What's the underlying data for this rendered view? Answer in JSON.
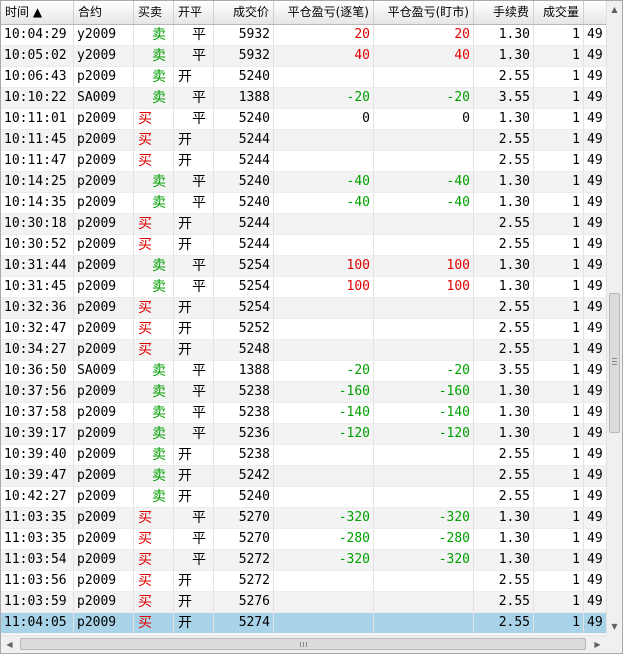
{
  "columns": [
    {
      "label": "时间 ▲",
      "align": "l"
    },
    {
      "label": "合约",
      "align": "l"
    },
    {
      "label": "买卖",
      "align": "l"
    },
    {
      "label": "开平",
      "align": "l"
    },
    {
      "label": "成交价",
      "align": "r"
    },
    {
      "label": "平仓盈亏(逐笔)",
      "align": "r"
    },
    {
      "label": "平仓盈亏(盯市)",
      "align": "r"
    },
    {
      "label": "手续费",
      "align": "r"
    },
    {
      "label": "成交量",
      "align": "r"
    },
    {
      "label": "",
      "align": "l"
    }
  ],
  "rows": [
    {
      "time": "10:04:29",
      "contract": "y2009",
      "side": "卖",
      "side_color": "green",
      "oc": "平",
      "price": "5932",
      "pnl_trade": "20",
      "pnl_mark": "20",
      "pnl_color": "red",
      "fee": "1.30",
      "qty": "1",
      "extra": "49"
    },
    {
      "time": "10:05:02",
      "contract": "y2009",
      "side": "卖",
      "side_color": "green",
      "oc": "平",
      "price": "5932",
      "pnl_trade": "40",
      "pnl_mark": "40",
      "pnl_color": "red",
      "fee": "1.30",
      "qty": "1",
      "extra": "49"
    },
    {
      "time": "10:06:43",
      "contract": "p2009",
      "side": "卖",
      "side_color": "green",
      "oc": "开",
      "price": "5240",
      "pnl_trade": "",
      "pnl_mark": "",
      "pnl_color": "black",
      "fee": "2.55",
      "qty": "1",
      "extra": "49"
    },
    {
      "time": "10:10:22",
      "contract": "SA009",
      "side": "卖",
      "side_color": "green",
      "oc": "平",
      "price": "1388",
      "pnl_trade": "-20",
      "pnl_mark": "-20",
      "pnl_color": "green",
      "fee": "3.55",
      "qty": "1",
      "extra": "49"
    },
    {
      "time": "10:11:01",
      "contract": "p2009",
      "side": "买",
      "side_color": "red",
      "oc": "平",
      "price": "5240",
      "pnl_trade": "0",
      "pnl_mark": "0",
      "pnl_color": "black",
      "fee": "1.30",
      "qty": "1",
      "extra": "49"
    },
    {
      "time": "10:11:45",
      "contract": "p2009",
      "side": "买",
      "side_color": "red",
      "oc": "开",
      "price": "5244",
      "pnl_trade": "",
      "pnl_mark": "",
      "pnl_color": "black",
      "fee": "2.55",
      "qty": "1",
      "extra": "49"
    },
    {
      "time": "10:11:47",
      "contract": "p2009",
      "side": "买",
      "side_color": "red",
      "oc": "开",
      "price": "5244",
      "pnl_trade": "",
      "pnl_mark": "",
      "pnl_color": "black",
      "fee": "2.55",
      "qty": "1",
      "extra": "49"
    },
    {
      "time": "10:14:25",
      "contract": "p2009",
      "side": "卖",
      "side_color": "green",
      "oc": "平",
      "price": "5240",
      "pnl_trade": "-40",
      "pnl_mark": "-40",
      "pnl_color": "green",
      "fee": "1.30",
      "qty": "1",
      "extra": "49"
    },
    {
      "time": "10:14:35",
      "contract": "p2009",
      "side": "卖",
      "side_color": "green",
      "oc": "平",
      "price": "5240",
      "pnl_trade": "-40",
      "pnl_mark": "-40",
      "pnl_color": "green",
      "fee": "1.30",
      "qty": "1",
      "extra": "49"
    },
    {
      "time": "10:30:18",
      "contract": "p2009",
      "side": "买",
      "side_color": "red",
      "oc": "开",
      "price": "5244",
      "pnl_trade": "",
      "pnl_mark": "",
      "pnl_color": "black",
      "fee": "2.55",
      "qty": "1",
      "extra": "49"
    },
    {
      "time": "10:30:52",
      "contract": "p2009",
      "side": "买",
      "side_color": "red",
      "oc": "开",
      "price": "5244",
      "pnl_trade": "",
      "pnl_mark": "",
      "pnl_color": "black",
      "fee": "2.55",
      "qty": "1",
      "extra": "49"
    },
    {
      "time": "10:31:44",
      "contract": "p2009",
      "side": "卖",
      "side_color": "green",
      "oc": "平",
      "price": "5254",
      "pnl_trade": "100",
      "pnl_mark": "100",
      "pnl_color": "red",
      "fee": "1.30",
      "qty": "1",
      "extra": "49"
    },
    {
      "time": "10:31:45",
      "contract": "p2009",
      "side": "卖",
      "side_color": "green",
      "oc": "平",
      "price": "5254",
      "pnl_trade": "100",
      "pnl_mark": "100",
      "pnl_color": "red",
      "fee": "1.30",
      "qty": "1",
      "extra": "49"
    },
    {
      "time": "10:32:36",
      "contract": "p2009",
      "side": "买",
      "side_color": "red",
      "oc": "开",
      "price": "5254",
      "pnl_trade": "",
      "pnl_mark": "",
      "pnl_color": "black",
      "fee": "2.55",
      "qty": "1",
      "extra": "49"
    },
    {
      "time": "10:32:47",
      "contract": "p2009",
      "side": "买",
      "side_color": "red",
      "oc": "开",
      "price": "5252",
      "pnl_trade": "",
      "pnl_mark": "",
      "pnl_color": "black",
      "fee": "2.55",
      "qty": "1",
      "extra": "49"
    },
    {
      "time": "10:34:27",
      "contract": "p2009",
      "side": "买",
      "side_color": "red",
      "oc": "开",
      "price": "5248",
      "pnl_trade": "",
      "pnl_mark": "",
      "pnl_color": "black",
      "fee": "2.55",
      "qty": "1",
      "extra": "49"
    },
    {
      "time": "10:36:50",
      "contract": "SA009",
      "side": "卖",
      "side_color": "green",
      "oc": "平",
      "price": "1388",
      "pnl_trade": "-20",
      "pnl_mark": "-20",
      "pnl_color": "green",
      "fee": "3.55",
      "qty": "1",
      "extra": "49"
    },
    {
      "time": "10:37:56",
      "contract": "p2009",
      "side": "卖",
      "side_color": "green",
      "oc": "平",
      "price": "5238",
      "pnl_trade": "-160",
      "pnl_mark": "-160",
      "pnl_color": "green",
      "fee": "1.30",
      "qty": "1",
      "extra": "49"
    },
    {
      "time": "10:37:58",
      "contract": "p2009",
      "side": "卖",
      "side_color": "green",
      "oc": "平",
      "price": "5238",
      "pnl_trade": "-140",
      "pnl_mark": "-140",
      "pnl_color": "green",
      "fee": "1.30",
      "qty": "1",
      "extra": "49"
    },
    {
      "time": "10:39:17",
      "contract": "p2009",
      "side": "卖",
      "side_color": "green",
      "oc": "平",
      "price": "5236",
      "pnl_trade": "-120",
      "pnl_mark": "-120",
      "pnl_color": "green",
      "fee": "1.30",
      "qty": "1",
      "extra": "49"
    },
    {
      "time": "10:39:40",
      "contract": "p2009",
      "side": "卖",
      "side_color": "green",
      "oc": "开",
      "price": "5238",
      "pnl_trade": "",
      "pnl_mark": "",
      "pnl_color": "black",
      "fee": "2.55",
      "qty": "1",
      "extra": "49"
    },
    {
      "time": "10:39:47",
      "contract": "p2009",
      "side": "卖",
      "side_color": "green",
      "oc": "开",
      "price": "5242",
      "pnl_trade": "",
      "pnl_mark": "",
      "pnl_color": "black",
      "fee": "2.55",
      "qty": "1",
      "extra": "49"
    },
    {
      "time": "10:42:27",
      "contract": "p2009",
      "side": "卖",
      "side_color": "green",
      "oc": "开",
      "price": "5240",
      "pnl_trade": "",
      "pnl_mark": "",
      "pnl_color": "black",
      "fee": "2.55",
      "qty": "1",
      "extra": "49"
    },
    {
      "time": "11:03:35",
      "contract": "p2009",
      "side": "买",
      "side_color": "red",
      "oc": "平",
      "price": "5270",
      "pnl_trade": "-320",
      "pnl_mark": "-320",
      "pnl_color": "green",
      "fee": "1.30",
      "qty": "1",
      "extra": "49"
    },
    {
      "time": "11:03:35",
      "contract": "p2009",
      "side": "买",
      "side_color": "red",
      "oc": "平",
      "price": "5270",
      "pnl_trade": "-280",
      "pnl_mark": "-280",
      "pnl_color": "green",
      "fee": "1.30",
      "qty": "1",
      "extra": "49"
    },
    {
      "time": "11:03:54",
      "contract": "p2009",
      "side": "买",
      "side_color": "red",
      "oc": "平",
      "price": "5272",
      "pnl_trade": "-320",
      "pnl_mark": "-320",
      "pnl_color": "green",
      "fee": "1.30",
      "qty": "1",
      "extra": "49"
    },
    {
      "time": "11:03:56",
      "contract": "p2009",
      "side": "买",
      "side_color": "red",
      "oc": "开",
      "price": "5272",
      "pnl_trade": "",
      "pnl_mark": "",
      "pnl_color": "black",
      "fee": "2.55",
      "qty": "1",
      "extra": "49"
    },
    {
      "time": "11:03:59",
      "contract": "p2009",
      "side": "买",
      "side_color": "red",
      "oc": "开",
      "price": "5276",
      "pnl_trade": "",
      "pnl_mark": "",
      "pnl_color": "black",
      "fee": "2.55",
      "qty": "1",
      "extra": "49"
    },
    {
      "time": "11:04:05",
      "contract": "p2009",
      "side": "买",
      "side_color": "red",
      "oc": "开",
      "price": "5274",
      "pnl_trade": "",
      "pnl_mark": "",
      "pnl_color": "black",
      "fee": "2.55",
      "qty": "1",
      "extra": "49",
      "selected": true
    }
  ],
  "colors": {
    "buy": "#e00000",
    "sell": "#00a000",
    "selected_row": "#a8d3e8",
    "alt_row": "#f3f3f3"
  },
  "scrollbars": {
    "vertical_up_icon": "triangle-up-icon",
    "vertical_down_icon": "triangle-down-icon",
    "horizontal_left_icon": "triangle-left-icon",
    "horizontal_right_icon": "triangle-right-icon"
  }
}
